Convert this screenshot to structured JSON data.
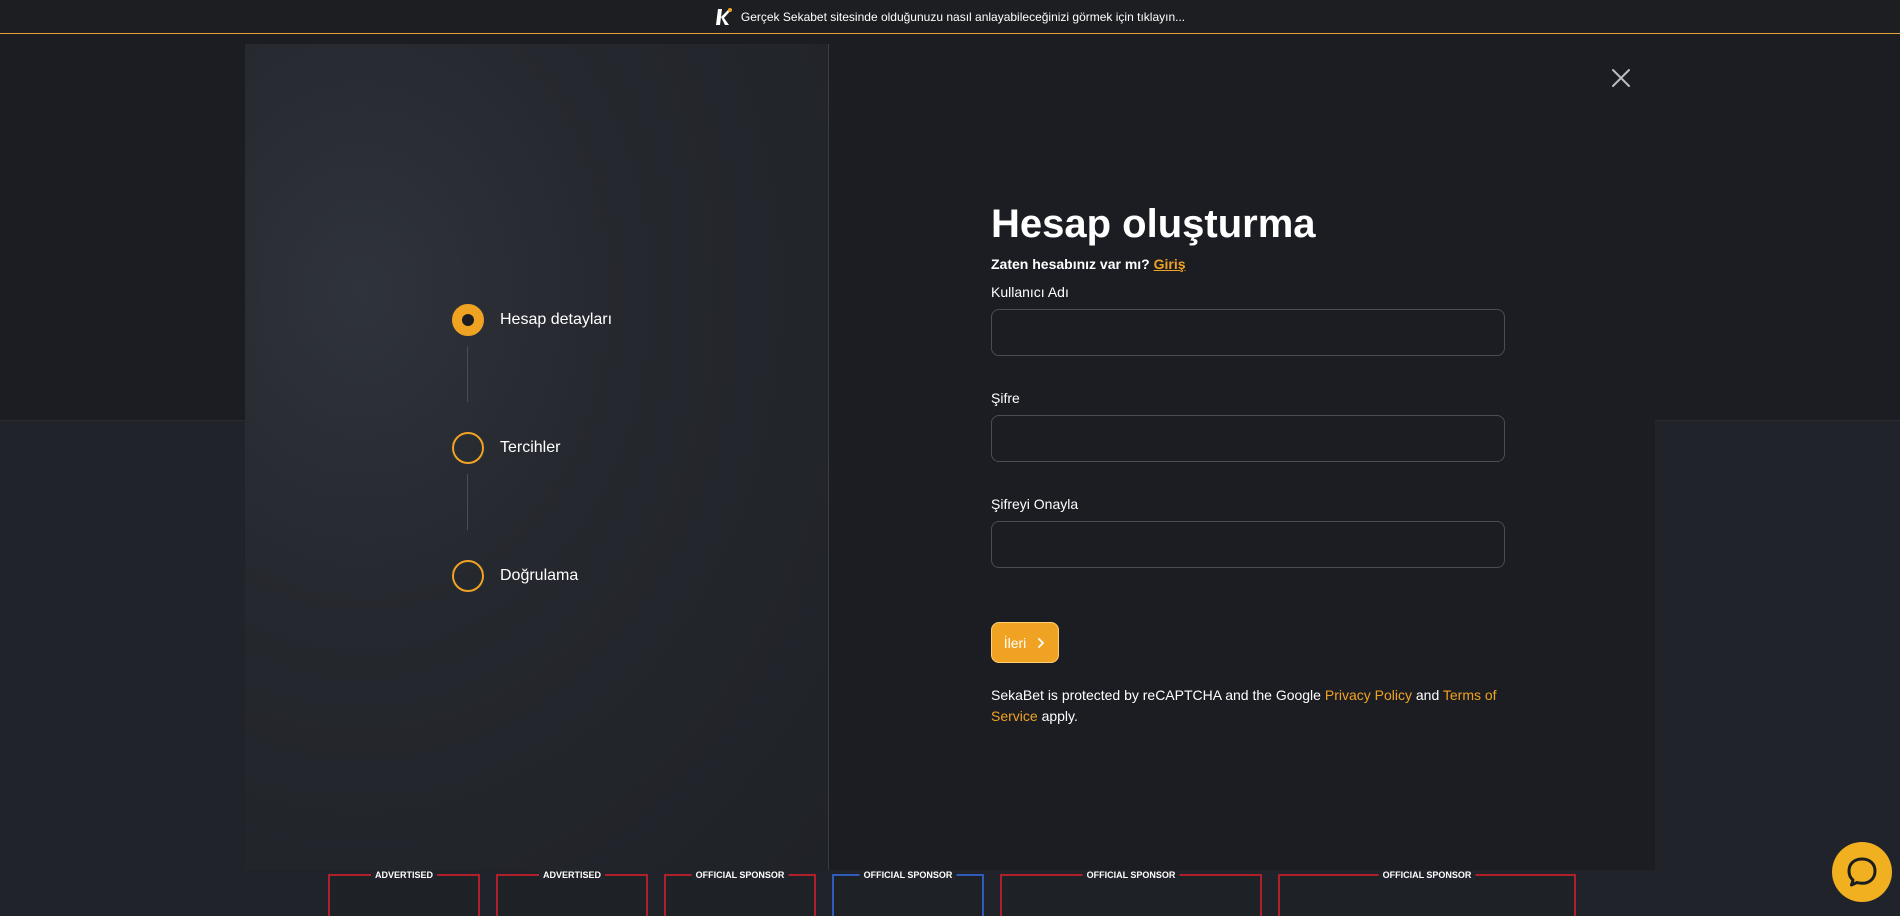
{
  "banner": {
    "text": "Gerçek Sekabet sitesinde olduğunuzu nasıl anlayabileceğinizi görmek için tıklayın..."
  },
  "steps": [
    {
      "label": "Hesap detayları",
      "active": true
    },
    {
      "label": "Tercihler",
      "active": false
    },
    {
      "label": "Doğrulama",
      "active": false
    }
  ],
  "form": {
    "title": "Hesap oluşturma",
    "login_prompt": "Zaten hesabınız var mı?",
    "login_link": "Giriş",
    "username_label": "Kullanıcı Adı",
    "password_label": "Şifre",
    "confirm_label": "Şifreyi Onayla",
    "next_label": "İleri",
    "captcha_text_1": "SekaBet is protected by reCAPTCHA and the Google",
    "privacy_link": "Privacy Policy",
    "captcha_and": "and",
    "terms_link": "Terms of Service",
    "captcha_text_2": "apply."
  },
  "sponsors": [
    {
      "caption": "ADVERTISED",
      "color": "#b0202a"
    },
    {
      "caption": "ADVERTISED",
      "color": "#b0202a"
    },
    {
      "caption": "OFFICIAL SPONSOR",
      "color": "#b0202a"
    },
    {
      "caption": "OFFICIAL SPONSOR",
      "color": "#2e5cb8"
    },
    {
      "caption": "OFFICIAL SPONSOR",
      "color": "#b0202a"
    },
    {
      "caption": "OFFICIAL SPONSOR",
      "color": "#b0202a"
    }
  ],
  "colors": {
    "accent": "#f0a322",
    "background": "#1b1d22",
    "chat": "#f0b020"
  },
  "icons": {
    "close": "close-icon",
    "chat": "chat-icon",
    "logo": "sekabet-logo-icon",
    "chevron": "chevron-right-icon"
  }
}
